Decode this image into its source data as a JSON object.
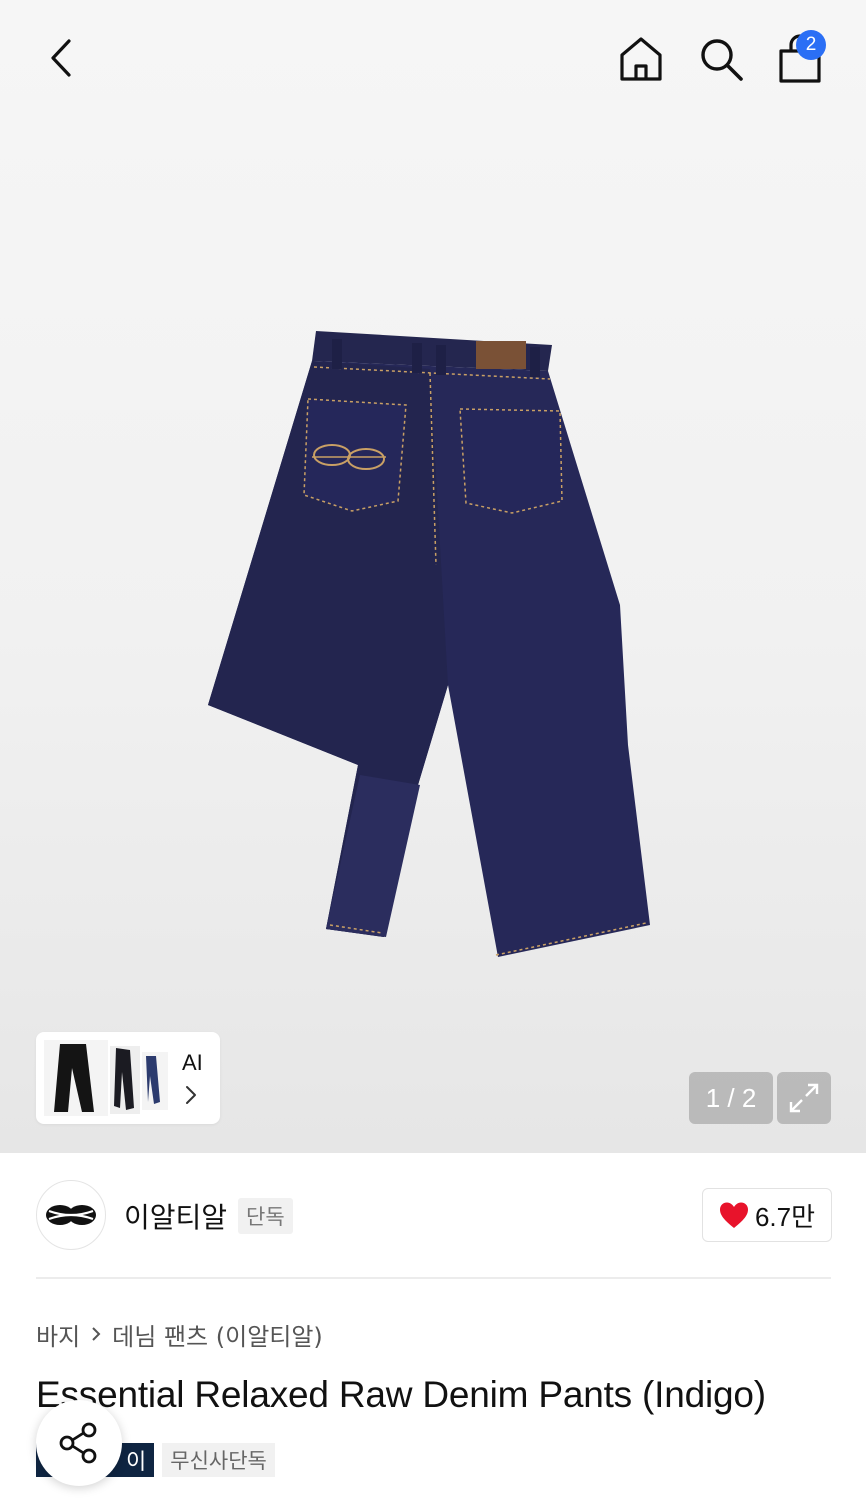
{
  "header": {
    "back_icon": "chevron-left-icon",
    "home_icon": "home-icon",
    "search_icon": "search-icon",
    "cart_icon": "shopping-bag-icon",
    "cart_count": "2"
  },
  "gallery": {
    "ai_label": "AI",
    "counter": "1 / 2",
    "expand_icon": "expand-icon"
  },
  "brand": {
    "name": "이알티알",
    "tag": "단독",
    "like_count": "6.7만"
  },
  "breadcrumb": {
    "items": [
      "바지",
      "데님 팬츠 (이알티알)"
    ]
  },
  "product": {
    "title": "Essential Relaxed Raw Denim Pants (Indigo)",
    "tags": [
      "이",
      "무신사단독"
    ]
  },
  "colors": {
    "badge": "#2b6ff5",
    "heart": "#e8132b",
    "denim": "#22244f",
    "tag_dark": "#0f2542"
  }
}
